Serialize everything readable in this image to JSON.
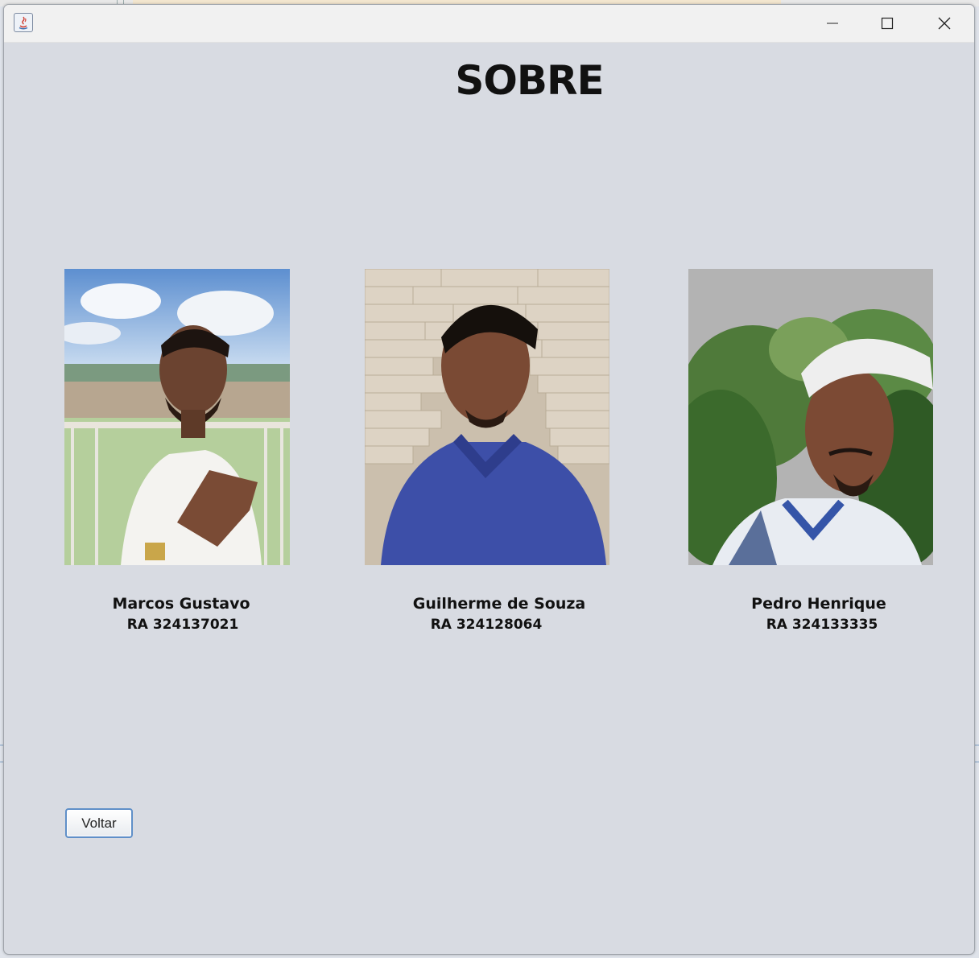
{
  "window": {
    "title": "",
    "controls": {
      "minimize_icon": "minimize-icon",
      "maximize_icon": "maximize-icon",
      "close_icon": "close-icon"
    }
  },
  "page": {
    "title": "SOBRE"
  },
  "members": [
    {
      "name": "Marcos Gustavo",
      "ra": "RA 324137021"
    },
    {
      "name": "Guilherme de Souza",
      "ra": "RA 324128064"
    },
    {
      "name": "Pedro Henrique",
      "ra": "RA 324133335"
    }
  ],
  "actions": {
    "back_label": "Voltar"
  },
  "colors": {
    "background": "#d8dbe2",
    "titlebar": "#f1f1f1",
    "button_border": "#5f8fc8"
  }
}
